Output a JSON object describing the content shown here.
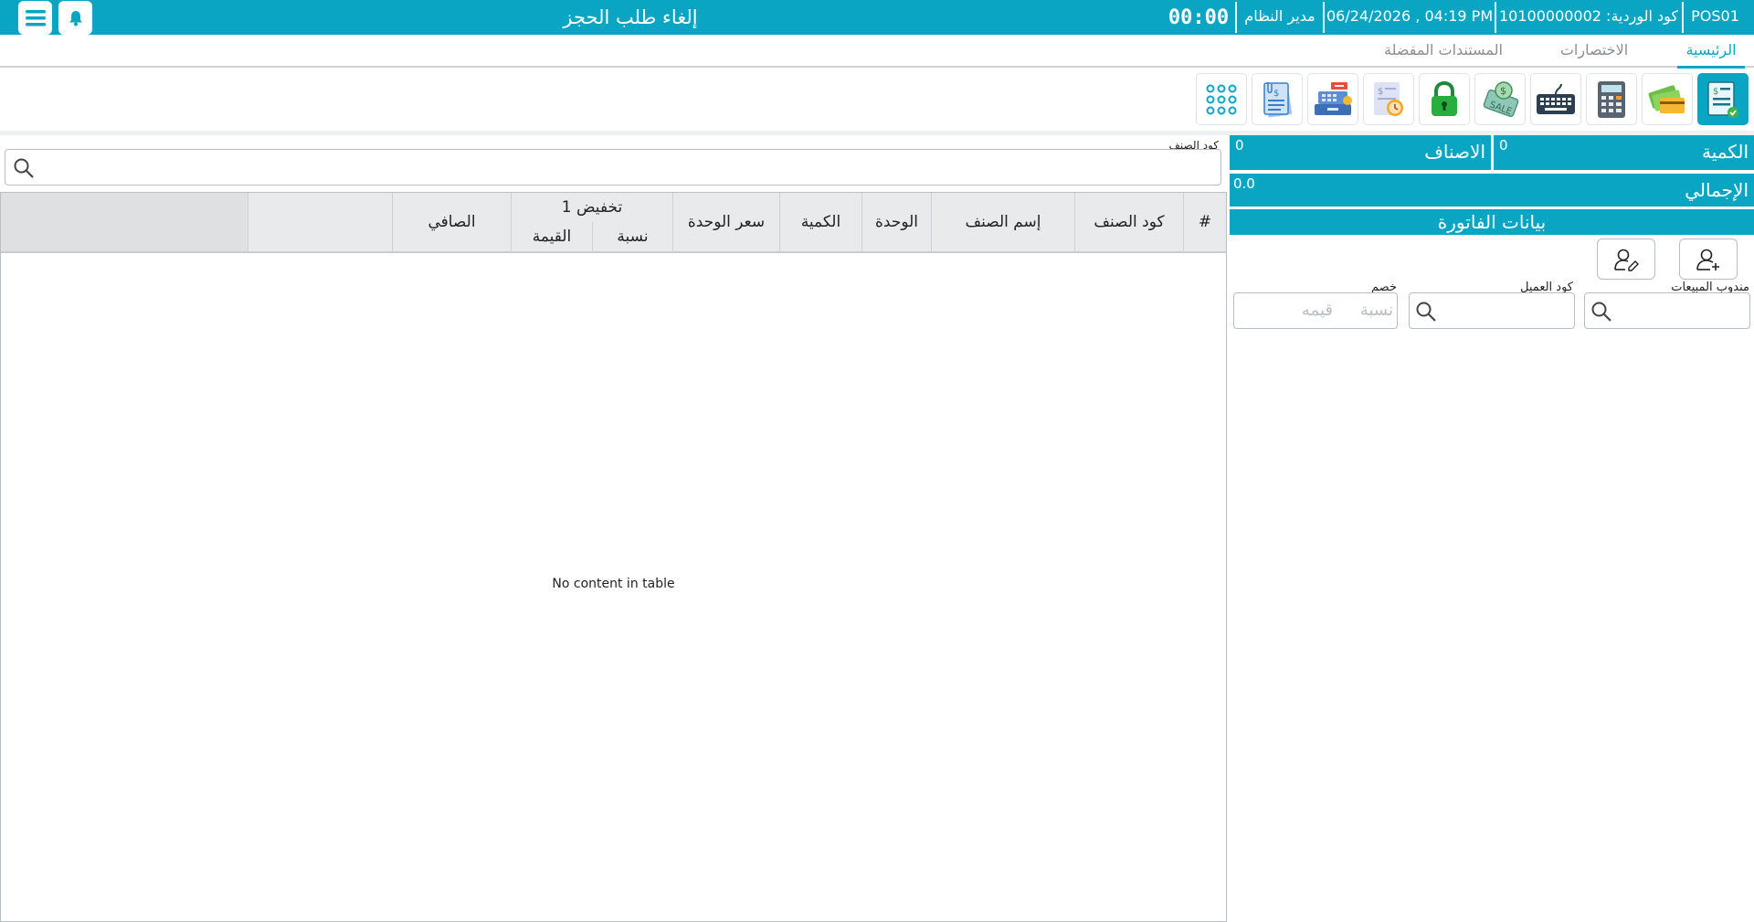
{
  "topbar": {
    "title": "إلغاء طلب الحجز",
    "timer": "00:00",
    "user": "مدير النظام",
    "datetime": "06/24/2026 , 04:19 PM",
    "shift_code": "كود الوردية: 10100000002",
    "pos_code": "POS01",
    "menu_icon": "hamburger-menu-icon",
    "notify_icon": "bell-icon"
  },
  "tabs": [
    {
      "label": "الرئيسية",
      "active": true
    },
    {
      "label": "الاختصارات",
      "active": false
    },
    {
      "label": "المستندات المفضلة",
      "active": false
    }
  ],
  "toolbar": [
    {
      "icon": "invoice-icon",
      "selected": true
    },
    {
      "icon": "cash-card-payment-icon",
      "selected": false
    },
    {
      "icon": "calculator-icon",
      "selected": false
    },
    {
      "icon": "keyboard-icon",
      "selected": false
    },
    {
      "icon": "sale-tag-icon",
      "selected": false
    },
    {
      "icon": "lock-icon",
      "selected": false
    },
    {
      "icon": "time-document-icon",
      "selected": false
    },
    {
      "icon": "cash-register-icon",
      "selected": false
    },
    {
      "icon": "documents-icon",
      "selected": false
    },
    {
      "icon": "numpad-icon",
      "selected": false
    }
  ],
  "summary": {
    "quantity_label": "الكمية",
    "quantity_value": "0",
    "items_label": "الاصناف",
    "items_value": "0",
    "total_label": "الإجمالي",
    "total_value": "0.0",
    "invoice_section_title": "بيانات الفاتورة"
  },
  "invoice": {
    "add_customer_icon": "add-user-icon",
    "edit_customer_icon": "edit-user-icon",
    "sales_rep_label": "مندوب المبيعات",
    "customer_code_label": "كود العميل",
    "discount_label": "خصم",
    "discount_percent_placeholder": "نسبة",
    "discount_value_placeholder": "قيمه"
  },
  "item_search": {
    "label": "كود الصنف"
  },
  "table": {
    "columns": [
      "#",
      "كود الصنف",
      "إسم الصنف",
      "الوحدة",
      "الكمية",
      "سعر الوحدة",
      "تخفيض 1",
      "الصافي"
    ],
    "discount_subcolumns": [
      "نسبة",
      "القيمة"
    ],
    "rows": [],
    "empty_message": "No content in table"
  },
  "colors": {
    "accent": "#0aa5c2",
    "header_bg": "#e9eaeb"
  }
}
